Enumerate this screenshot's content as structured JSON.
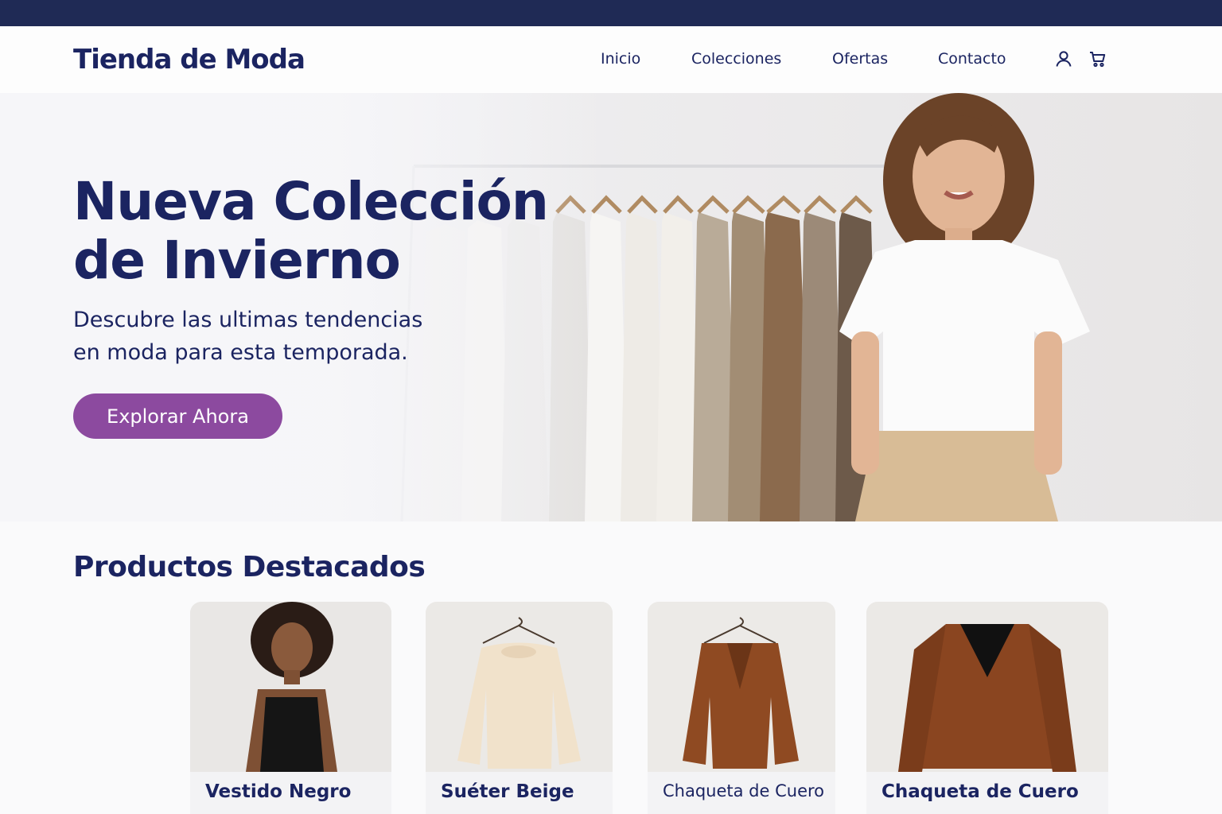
{
  "brand": {
    "name": "Tienda de Moda"
  },
  "nav": {
    "links": [
      "Inicio",
      "Colecciones",
      "Ofertas",
      "Contacto"
    ],
    "icons": [
      "user-icon",
      "cart-icon"
    ]
  },
  "hero": {
    "title": "Nueva Colección de Invierno",
    "subtitle": "Descubre las ultimas tendencias en moda para esta temporada.",
    "cta": "Explorar Ahora"
  },
  "featured": {
    "title": "Productos Destacados",
    "products": [
      {
        "name": "Vestido Negro"
      },
      {
        "name": "Suéter Beige"
      },
      {
        "name": "Chaqueta de Cuero"
      },
      {
        "name": "Chaqueta de Cuero"
      }
    ]
  },
  "colors": {
    "navy": "#1b2461",
    "top_bar": "#1f2a55",
    "accent": "#8c4a9f"
  }
}
